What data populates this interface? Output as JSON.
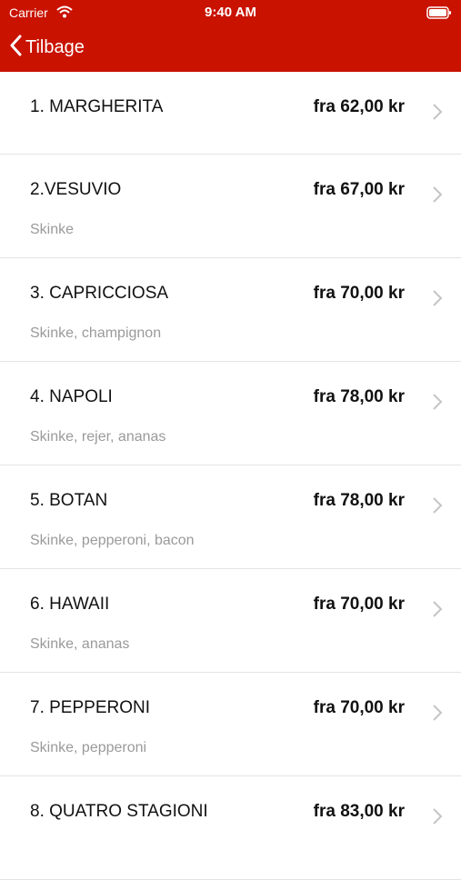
{
  "status": {
    "carrier": "Carrier",
    "time": "9:40 AM"
  },
  "nav": {
    "back_label": "Tilbage"
  },
  "items": [
    {
      "name": "1. MARGHERITA",
      "price": "fra 62,00 kr",
      "description": ""
    },
    {
      "name": "2.VESUVIO",
      "price": "fra 67,00 kr",
      "description": "Skinke"
    },
    {
      "name": "3. CAPRICCIOSA",
      "price": "fra 70,00 kr",
      "description": "Skinke, champignon"
    },
    {
      "name": "4. NAPOLI",
      "price": "fra 78,00 kr",
      "description": "Skinke, rejer, ananas"
    },
    {
      "name": "5. BOTAN",
      "price": "fra 78,00 kr",
      "description": "Skinke, pepperoni, bacon"
    },
    {
      "name": "6. HAWAII",
      "price": "fra 70,00 kr",
      "description": "Skinke, ananas"
    },
    {
      "name": "7. PEPPERONI",
      "price": "fra 70,00 kr",
      "description": "Skinke, pepperoni"
    },
    {
      "name": "8. QUATRO STAGIONI",
      "price": "fra 83,00 kr",
      "description": ""
    }
  ],
  "colors": {
    "header": "#c91200",
    "secondary_text": "#9a9a9a"
  }
}
